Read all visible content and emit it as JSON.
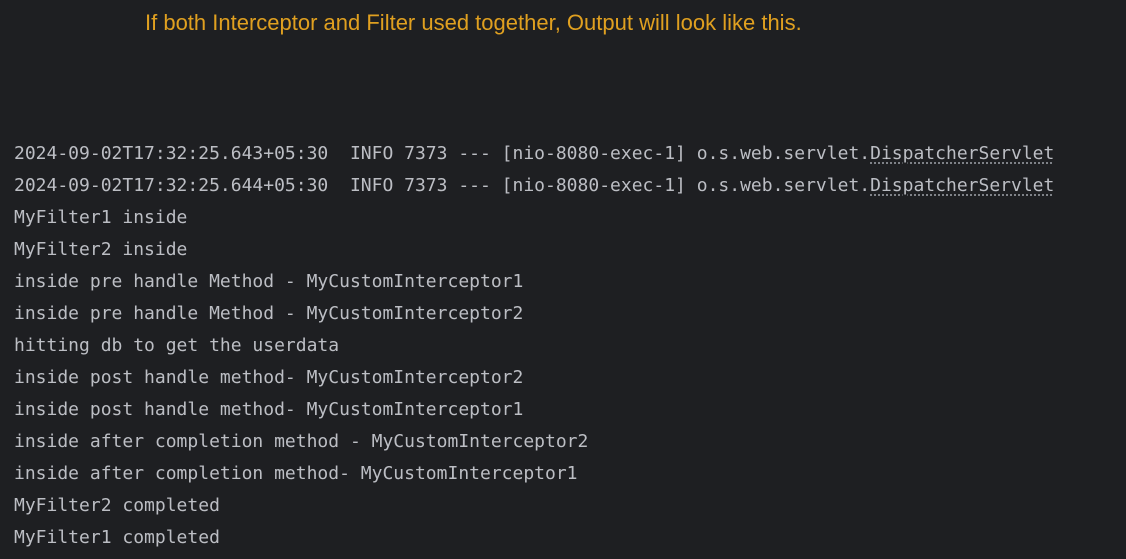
{
  "caption": "If both Interceptor and Filter used together, Output will look like this.",
  "console": {
    "log_lines": [
      {
        "prefix": "2024-09-02T17:32:25.643+05:30  INFO 7373 --- [nio-8080-exec-1] o.s.web.servlet.",
        "class_name": "DispatcherServlet"
      },
      {
        "prefix": "2024-09-02T17:32:25.644+05:30  INFO 7373 --- [nio-8080-exec-1] o.s.web.servlet.",
        "class_name": "DispatcherServlet"
      }
    ],
    "lines": [
      "MyFilter1 inside",
      "MyFilter2 inside",
      "inside pre handle Method - MyCustomInterceptor1",
      "inside pre handle Method - MyCustomInterceptor2",
      "hitting db to get the userdata",
      "inside post handle method- MyCustomInterceptor2",
      "inside post handle method- MyCustomInterceptor1",
      "inside after completion method - MyCustomInterceptor2",
      "inside after completion method- MyCustomInterceptor1",
      "MyFilter2 completed",
      "MyFilter1 completed"
    ]
  }
}
